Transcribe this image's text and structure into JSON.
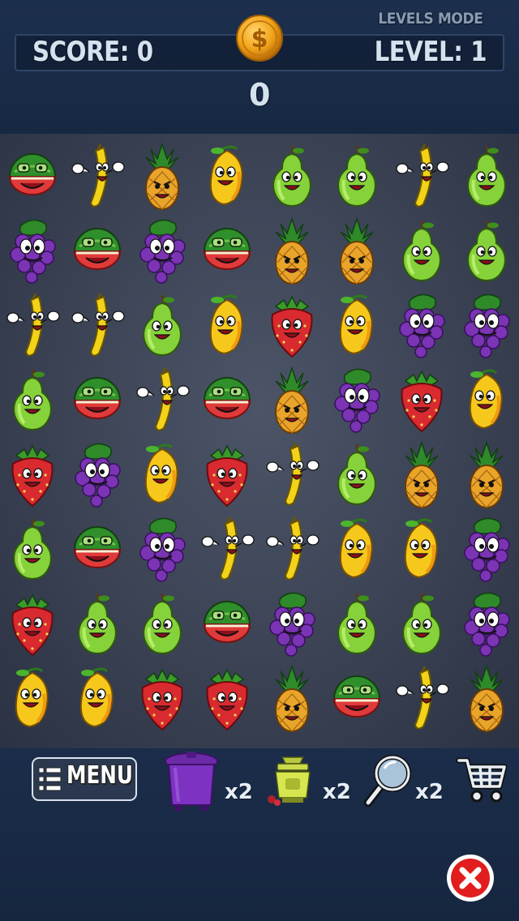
{
  "hud": {
    "score_label": "SCORE: 0",
    "level_label": "LEVEL: 1",
    "mode_label": "LEVELS MODE",
    "coins": "0"
  },
  "board": {
    "columns": 8,
    "rows": 8,
    "grid": [
      [
        "watermelon",
        "banana",
        "pineapple",
        "mango",
        "pear",
        "pear",
        "banana",
        "pear"
      ],
      [
        "grape",
        "watermelon",
        "grape",
        "watermelon",
        "pineapple",
        "pineapple",
        "pear",
        "pear"
      ],
      [
        "banana",
        "banana",
        "pear",
        "mango",
        "strawberry",
        "mango",
        "grape",
        "grape"
      ],
      [
        "pear",
        "watermelon",
        "banana",
        "watermelon",
        "pineapple",
        "grape",
        "strawberry",
        "mango"
      ],
      [
        "strawberry",
        "grape",
        "mango",
        "strawberry",
        "banana",
        "pear",
        "pineapple",
        "pineapple"
      ],
      [
        "pear",
        "watermelon",
        "grape",
        "banana",
        "banana",
        "mango",
        "mango",
        "grape"
      ],
      [
        "strawberry",
        "pear",
        "pear",
        "watermelon",
        "grape",
        "pear",
        "pear",
        "grape"
      ],
      [
        "mango",
        "mango",
        "strawberry",
        "strawberry",
        "pineapple",
        "watermelon",
        "banana",
        "pineapple"
      ]
    ]
  },
  "toolbar": {
    "menu_label": "MENU",
    "tools": [
      {
        "icon": "trash-bin-icon",
        "count": "x2"
      },
      {
        "icon": "juicer-icon",
        "count": "x2"
      },
      {
        "icon": "magnifier-icon",
        "count": "x2"
      }
    ],
    "shop_icon": "cart-icon",
    "close_icon": "close-icon"
  },
  "colors": {
    "background": "#1b2d4a",
    "board": "#3e4657",
    "coin": "#f2a51a",
    "close_button": "#e11d1d"
  }
}
